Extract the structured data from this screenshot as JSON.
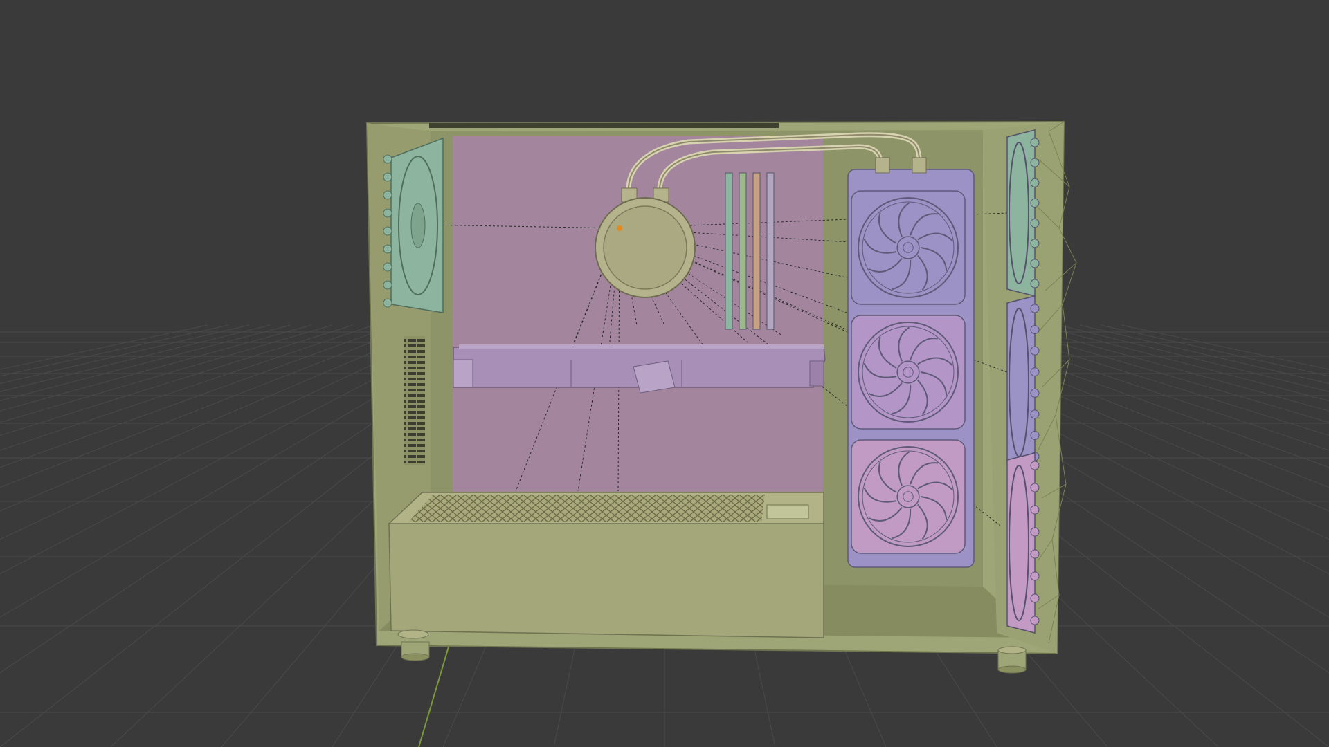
{
  "viewport": {
    "background_color": "#3a3a3a",
    "grid_line_color": "#4a4a4a",
    "y_axis_color": "#7a9a3a"
  },
  "scene": {
    "case_color": "#9ea577",
    "case_inner_color": "#8d9468",
    "motherboard_color": "#a3869e",
    "gpu_color": "#a88fb8",
    "psu_color": "#a4a77a",
    "cpu_cooler_color": "#b5b38c",
    "radiator_colors": [
      "#9c92c6",
      "#b396c7",
      "#c19bc4"
    ],
    "side_fan_colors": [
      "#8db49e",
      "#9b93c6",
      "#c39ac4"
    ],
    "rear_fan_color": "#8db49e",
    "ram_stick_colors": [
      "#8ab7a0",
      "#9db98c",
      "#c8a286",
      "#b3a6c0"
    ],
    "connection_line_color": "#2b2b2b",
    "origin_marker_color": "#e28a1e"
  }
}
